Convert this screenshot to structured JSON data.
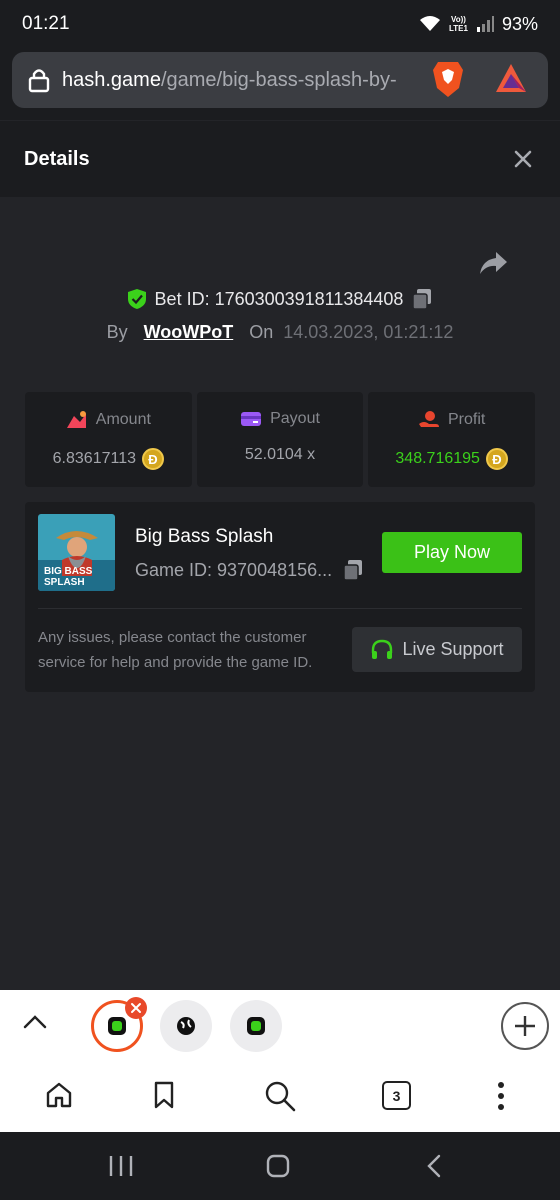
{
  "status_bar": {
    "time": "01:21",
    "network_top": "Vo))",
    "network_bottom": "LTE1",
    "battery": "93%"
  },
  "browser": {
    "url_domain": "hash.game",
    "url_path": "/game/big-bass-splash-by-"
  },
  "details": {
    "title": "Details"
  },
  "bet": {
    "bet_id_label": "Bet ID: 1760300391811384408",
    "by_label": "By",
    "user": "WooWPoT",
    "on_label": "On",
    "date": "14.03.2023, 01:21:12"
  },
  "stats": {
    "amount_label": "Amount",
    "amount_value": "6.83617113",
    "payout_label": "Payout",
    "payout_value": "52.0104 x",
    "profit_label": "Profit",
    "profit_value": "348.716195",
    "currency_symbol": "Ð"
  },
  "game": {
    "name": "Big Bass Splash",
    "game_id": "Game ID: 9370048156...",
    "play_label": "Play Now",
    "thumb_text_1": "BIG BASS",
    "thumb_text_2": "SPLASH",
    "help_text": "Any issues, please contact the customer service for help and provide the game ID.",
    "live_support_label": "Live Support"
  },
  "tabs": {
    "open_count": "3"
  },
  "colors": {
    "accent_green": "#3bc117",
    "profit_green": "#3bd11b",
    "brave_orange": "#f0521f"
  }
}
